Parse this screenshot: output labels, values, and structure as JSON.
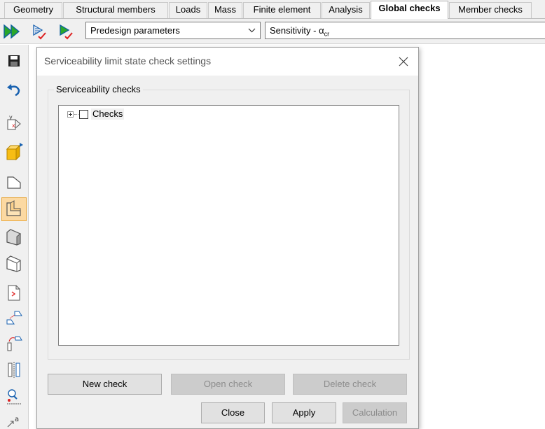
{
  "tabs": [
    {
      "label": "Geometry",
      "active": false
    },
    {
      "label": "Structural members",
      "active": false
    },
    {
      "label": "Loads",
      "active": false
    },
    {
      "label": "Mass",
      "active": false
    },
    {
      "label": "Finite element",
      "active": false
    },
    {
      "label": "Analysis",
      "active": false
    },
    {
      "label": "Global checks",
      "active": true
    },
    {
      "label": "Member checks",
      "active": false
    }
  ],
  "toolbar": {
    "icons": [
      "run-all-icon",
      "check-report-icon",
      "check-run-icon"
    ],
    "design_dropdown": {
      "selected": "Predesign parameters"
    },
    "sensitivity_field": {
      "prefix": "Sensitivity - α",
      "subscript": "cr"
    }
  },
  "sidebar": {
    "icons": [
      "save-icon",
      "undo-icon",
      "node-coordinates-icon",
      "cube-icon",
      "section-outline-icon",
      "section-plate-icon",
      "section-solid-icon",
      "section-open-icon",
      "document-import-icon",
      "member-copy-icon",
      "member-rotate-icon",
      "mirror-icon",
      "node-search-icon",
      "label-icon"
    ],
    "active_index": 5
  },
  "dialog": {
    "title": "Serviceability limit state check settings",
    "group_label": "Serviceability checks",
    "tree": {
      "root_label": "Checks",
      "checked": false,
      "expanded": false
    },
    "buttons": {
      "new_check": "New check",
      "open_check": "Open check",
      "delete_check": "Delete check",
      "close": "Close",
      "apply": "Apply",
      "calculation": "Calculation"
    }
  }
}
